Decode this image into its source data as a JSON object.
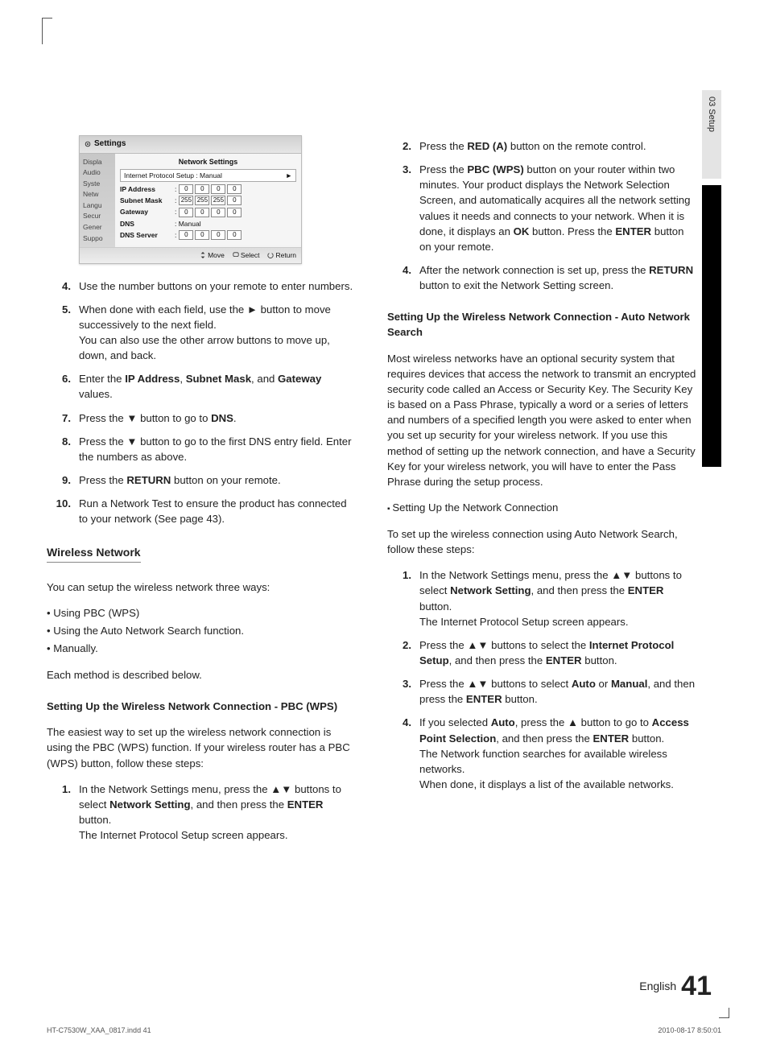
{
  "side_tab": "03   Setup",
  "panel": {
    "header": "Settings",
    "title": "Network Settings",
    "first_row": "Internet Protocol Setup   : Manual",
    "side_items": [
      "Displa",
      "Audio",
      "Syste",
      "Netw",
      "Langu",
      "Secur",
      "Gener",
      "Suppo"
    ],
    "rows": [
      {
        "label": "IP Address",
        "octets": [
          "0",
          "0",
          "0",
          "0"
        ]
      },
      {
        "label": "Subnet Mask",
        "octets": [
          "255",
          "255",
          "255",
          "0"
        ]
      },
      {
        "label": "Gateway",
        "octets": [
          "0",
          "0",
          "0",
          "0"
        ]
      },
      {
        "label": "DNS",
        "plain": ": Manual"
      },
      {
        "label": "DNS Server",
        "octets": [
          "0",
          "0",
          "0",
          "0"
        ]
      }
    ],
    "nav": {
      "move": "Move",
      "select": "Select",
      "return": "Return"
    }
  },
  "left": {
    "steps": [
      {
        "n": "4.",
        "t": "Use the number buttons on your remote to enter numbers."
      },
      {
        "n": "5.",
        "t": "When done with each field, use the ► button to move successively to the next field.\nYou can also use the other arrow buttons to move up, down, and back."
      },
      {
        "n": "6.",
        "t": "Enter the <b>IP Address</b>, <b>Subnet Mask</b>, and <b>Gateway</b> values."
      },
      {
        "n": "7.",
        "t": "Press the ▼ button to go to <b>DNS</b>."
      },
      {
        "n": "8.",
        "t": "Press the ▼ button to go to the first DNS entry field. Enter the numbers as above."
      },
      {
        "n": "9.",
        "t": "Press the <b>RETURN</b> button on your remote."
      },
      {
        "n": "10.",
        "t": "Run a Network Test to ensure the product has connected to your network (See page 43)."
      }
    ],
    "h_wireless": "Wireless Network",
    "wireless_intro": "You can setup the wireless network three ways:",
    "wireless_bullets": [
      "Using PBC (WPS)",
      "Using the Auto Network Search function.",
      "Manually."
    ],
    "wireless_note": "Each method is described below.",
    "h_pbc": "Setting Up the Wireless Network Connection - PBC (WPS)",
    "pbc_intro": "The easiest way to set up the wireless network connection is using the PBC (WPS) function. If your wireless router has a PBC (WPS) button, follow these steps:",
    "pbc_step": {
      "n": "1.",
      "t": "In the Network Settings menu, press the ▲▼ buttons to select <b>Network Setting</b>, and then press the <b>ENTER</b> button.\nThe Internet Protocol Setup screen appears."
    }
  },
  "right": {
    "steps_top": [
      {
        "n": "2.",
        "t": "Press the <b>RED (A)</b> button on the remote control."
      },
      {
        "n": "3.",
        "t": "Press the <b>PBC (WPS)</b> button on your router within two minutes. Your product displays the Network Selection Screen, and automatically acquires all the network setting values it needs and connects to your network. When it is done, it displays an <b>OK</b> button. Press the <b>ENTER</b> button on your remote."
      },
      {
        "n": "4.",
        "t": "After the network connection is set up, press the <b>RETURN</b> button to exit the Network Setting screen."
      }
    ],
    "h_auto": "Setting Up the Wireless Network Connection - Auto Network Search",
    "auto_para": "Most wireless networks have an optional security system that requires devices that access the network to transmit an encrypted security code called an Access or Security Key. The Security Key is based on a Pass Phrase, typically a word or a series of letters and numbers of a specified length you were asked to enter when you set up security for your wireless network. If you use this method of setting up the network connection, and have a Security Key for your wireless network, you will have to enter the Pass Phrase during the setup process.",
    "sq_item": "Setting Up the Network Connection",
    "auto_intro": "To set up the wireless connection using Auto Network Search, follow these steps:",
    "auto_steps": [
      {
        "n": "1.",
        "t": "In the Network Settings menu, press the ▲▼ buttons to select <b>Network Setting</b>, and then press the <b>ENTER</b> button.\nThe Internet Protocol Setup screen appears."
      },
      {
        "n": "2.",
        "t": "Press the ▲▼ buttons to select the <b>Internet Protocol Setup</b>, and then press the <b>ENTER</b> button."
      },
      {
        "n": "3.",
        "t": "Press the ▲▼ buttons to select <b>Auto</b> or <b>Manual</b>, and then press the <b>ENTER</b> button."
      },
      {
        "n": "4.",
        "t": "If you selected <b>Auto</b>, press the ▲ button to go to <b>Access Point Selection</b>, and then press the <b>ENTER</b> button.\nThe Network function searches for available wireless networks.\nWhen done, it displays a list of the available networks."
      }
    ]
  },
  "footer": {
    "lang": "English",
    "page": "41"
  },
  "print": {
    "left": "HT-C7530W_XAA_0817.indd   41",
    "right": "2010-08-17    8:50:01"
  }
}
